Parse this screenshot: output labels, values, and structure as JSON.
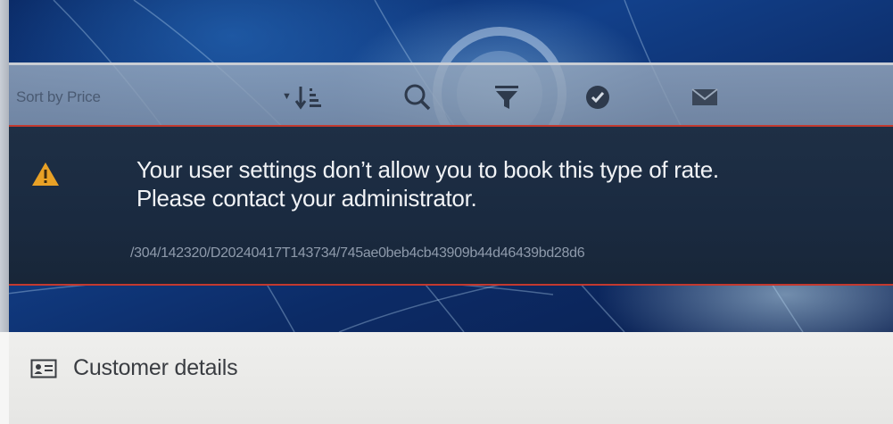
{
  "toolbar": {
    "sort_label": "Sort by Price",
    "icons": [
      "chevron-down-icon",
      "sort-descending-icon",
      "search-icon",
      "filter-icon",
      "verified-icon",
      "mail-icon"
    ]
  },
  "alert": {
    "line1": "Your user settings don’t allow you to book this type of rate.",
    "line2": "Please contact your administrator.",
    "code": "/304/142320/D20240417T143734/745ae0beb4cb43909b44d46439bd28d6",
    "icon": "warning-icon",
    "accent_color": "#c2392f",
    "warning_color": "#e8a126"
  },
  "section": {
    "title": "Customer details",
    "icon": "id-card-icon"
  }
}
